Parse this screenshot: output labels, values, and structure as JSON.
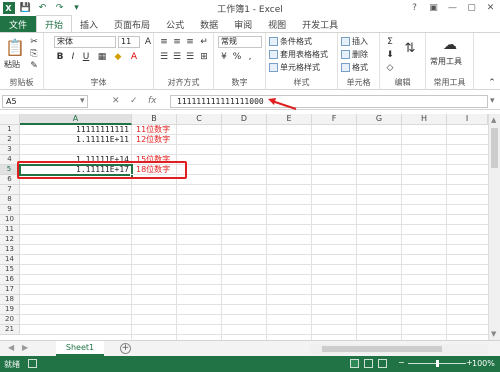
{
  "window": {
    "title": "工作簿1 - Excel",
    "help": "?",
    "minimize": "—",
    "restore": "▢",
    "close": "✕"
  },
  "qat": {
    "logo": "X"
  },
  "tabs": [
    "开始",
    "插入",
    "页面布局",
    "公式",
    "数据",
    "审阅",
    "视图",
    "开发工具"
  ],
  "file_tab": "文件",
  "ribbon": {
    "clipboard": {
      "paste": "粘贴",
      "label": "剪贴板"
    },
    "font": {
      "name": "宋体",
      "size": "11",
      "bold": "B",
      "italic": "I",
      "underline": "U",
      "grow": "A",
      "shrink": "A",
      "label": "字体"
    },
    "alignment": {
      "label": "对齐方式"
    },
    "number": {
      "format": "常规",
      "percent": "%",
      "comma": ",",
      "label": "数字"
    },
    "styles": {
      "conditional": "条件格式",
      "table": "套用表格格式",
      "cell": "单元格样式",
      "label": "样式"
    },
    "cells": {
      "insert": "插入",
      "delete": "删除",
      "format": "格式",
      "label": "单元格"
    },
    "editing": {
      "label": "编辑"
    },
    "tools": {
      "common": "常用工具",
      "label": "常用工具"
    }
  },
  "formula_bar": {
    "name_box": "A5",
    "cancel": "✕",
    "enter": "✓",
    "fx": "fx",
    "value": "111111111111111000"
  },
  "columns": [
    "A",
    "B",
    "C",
    "D",
    "E",
    "F",
    "G",
    "H",
    "I"
  ],
  "rows": [
    "1",
    "2",
    "3",
    "4",
    "5",
    "6",
    "7",
    "8",
    "9",
    "10",
    "11",
    "12",
    "13",
    "14",
    "15",
    "16",
    "17",
    "18",
    "19",
    "20",
    "21"
  ],
  "cells": [
    {
      "a": "11111111111",
      "b": "11位数字"
    },
    {
      "a": "1.11111E+11",
      "b": "12位数字"
    },
    {
      "a": "",
      "b": ""
    },
    {
      "a": "1.11111E+14",
      "b": "15位数字"
    },
    {
      "a": "1.11111E+17",
      "b": "18位数字"
    }
  ],
  "sheet": {
    "name": "Sheet1",
    "add": "+",
    "prev": "◀",
    "next": "▶"
  },
  "status": {
    "text": "就绪",
    "zoom": "100%",
    "zoom_minus": "−",
    "zoom_plus": "+"
  },
  "colors": {
    "excel_green": "#217346",
    "annotation_red": "#e02020"
  },
  "icons": [
    "save-icon",
    "undo-icon",
    "redo-icon",
    "paste-icon",
    "bold-icon",
    "italic-icon",
    "underline-icon",
    "insert-function-icon",
    "chevron-down-icon",
    "common-tools-icon"
  ]
}
